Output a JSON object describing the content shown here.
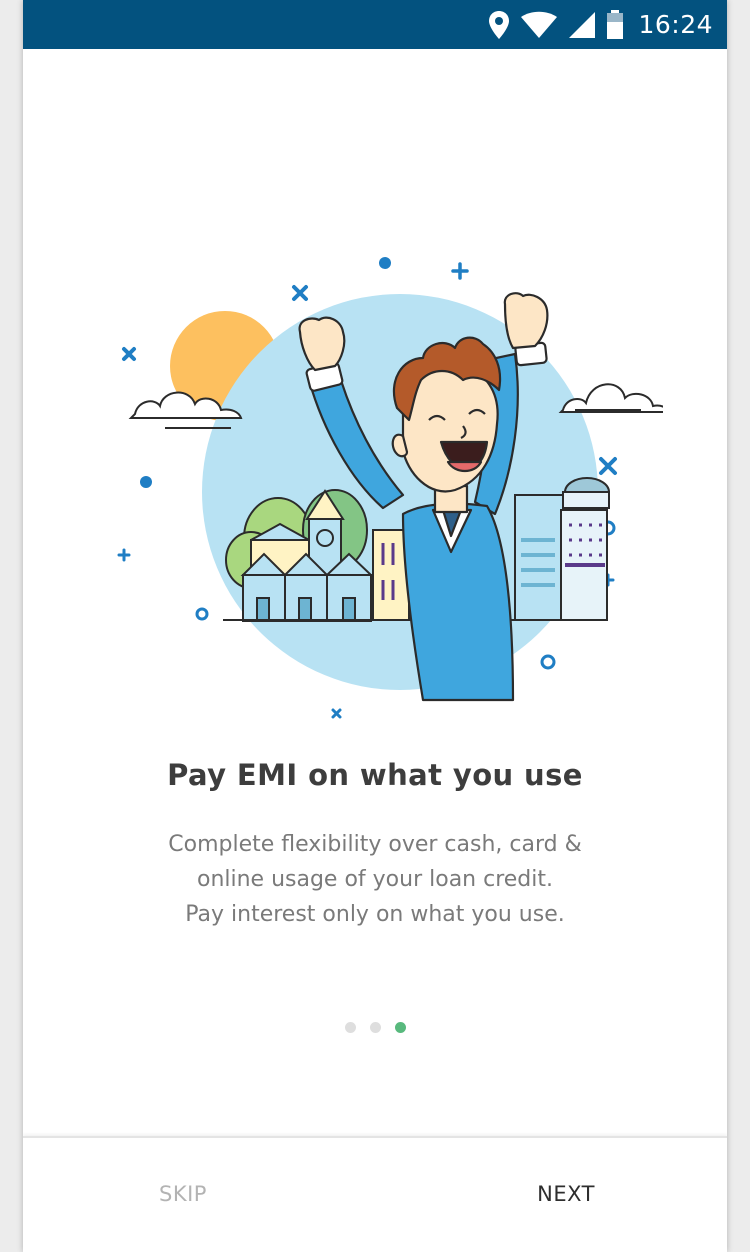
{
  "status_bar": {
    "time": "16:24",
    "icons": [
      "location-icon",
      "wifi-icon",
      "signal-icon",
      "battery-icon"
    ],
    "background": "#03527f"
  },
  "onboarding": {
    "title": "Pay EMI on what you use",
    "description_lines": [
      "Complete flexibility over cash, card &",
      "online usage of your loan credit.",
      "Pay interest only on what you use."
    ],
    "page_indicator": {
      "total": 3,
      "active_index": 2,
      "active_color": "#58b97d"
    }
  },
  "footer": {
    "skip_label": "SKIP",
    "next_label": "NEXT"
  }
}
